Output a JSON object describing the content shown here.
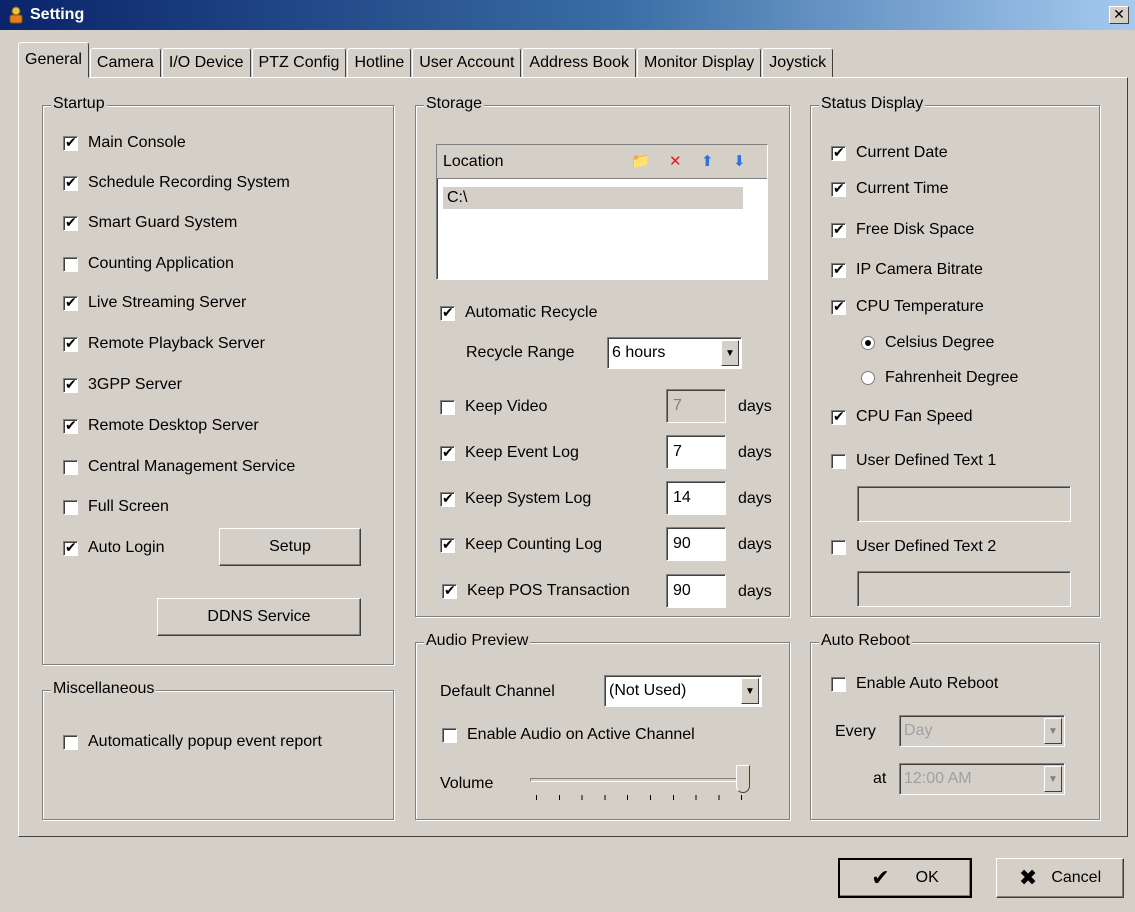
{
  "window": {
    "title": "Setting"
  },
  "tabs": [
    "General",
    "Camera",
    "I/O Device",
    "PTZ Config",
    "Hotline",
    "User Account",
    "Address Book",
    "Monitor Display",
    "Joystick"
  ],
  "startup": {
    "title": "Startup",
    "items": [
      {
        "label": "Main Console",
        "checked": true
      },
      {
        "label": "Schedule Recording System",
        "checked": true
      },
      {
        "label": "Smart Guard System",
        "checked": true
      },
      {
        "label": "Counting Application",
        "checked": false
      },
      {
        "label": "Live Streaming Server",
        "checked": true
      },
      {
        "label": "Remote Playback Server",
        "checked": true
      },
      {
        "label": "3GPP Server",
        "checked": true
      },
      {
        "label": "Remote Desktop Server",
        "checked": true
      },
      {
        "label": "Central Management Service",
        "checked": false
      },
      {
        "label": "Full Screen",
        "checked": false
      },
      {
        "label": "Auto Login",
        "checked": true
      }
    ],
    "setup_label": "Setup",
    "ddns_label": "DDNS Service"
  },
  "misc": {
    "title": "Miscellaneous",
    "popup_label": "Automatically popup event report",
    "popup_checked": false
  },
  "storage": {
    "title": "Storage",
    "location_header": "Location",
    "location_value": "C:\\",
    "auto_recycle_label": "Automatic Recycle",
    "auto_recycle_checked": true,
    "recycle_range_label": "Recycle Range",
    "recycle_range_value": "6 hours",
    "days_label": "days",
    "keeps": [
      {
        "label": "Keep Video",
        "checked": false,
        "value": "7",
        "disabled": true
      },
      {
        "label": "Keep Event Log",
        "checked": true,
        "value": "7",
        "disabled": false
      },
      {
        "label": "Keep System Log",
        "checked": true,
        "value": "14",
        "disabled": false
      },
      {
        "label": "Keep Counting Log",
        "checked": true,
        "value": "90",
        "disabled": false
      },
      {
        "label": "Keep POS Transaction",
        "checked": true,
        "value": "90",
        "disabled": false
      }
    ]
  },
  "audio": {
    "title": "Audio Preview",
    "default_channel_label": "Default Channel",
    "default_channel_value": "(Not Used)",
    "enable_active_label": "Enable Audio on Active Channel",
    "enable_active_checked": false,
    "volume_label": "Volume",
    "volume_level": 1.0
  },
  "status": {
    "title": "Status Display",
    "current_date": {
      "label": "Current Date",
      "checked": true
    },
    "current_time": {
      "label": "Current Time",
      "checked": true
    },
    "free_disk": {
      "label": "Free Disk Space",
      "checked": true
    },
    "ip_bitrate": {
      "label": "IP Camera Bitrate",
      "checked": true
    },
    "cpu_temp": {
      "label": "CPU Temperature",
      "checked": true
    },
    "celsius": {
      "label": "Celsius Degree",
      "selected": true
    },
    "fahrenheit": {
      "label": "Fahrenheit Degree",
      "selected": false
    },
    "cpu_fan": {
      "label": "CPU Fan Speed",
      "checked": true
    },
    "user_text1": {
      "label": "User Defined Text 1",
      "checked": false,
      "value": ""
    },
    "user_text2": {
      "label": "User Defined Text 2",
      "checked": false,
      "value": ""
    }
  },
  "reboot": {
    "title": "Auto Reboot",
    "enable_label": "Enable Auto Reboot",
    "enable_checked": false,
    "every_label": "Every",
    "every_value": "Day",
    "at_label": "at",
    "at_value": "12:00 AM"
  },
  "footer": {
    "ok_label": "OK",
    "cancel_label": "Cancel"
  }
}
